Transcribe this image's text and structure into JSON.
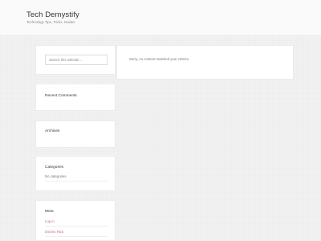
{
  "site": {
    "title": "Tech Demystify",
    "description": "Technology Tips, Tricks, Guides"
  },
  "search": {
    "placeholder": "Search this website…"
  },
  "widgets": {
    "recent_comments": {
      "title": "Recent Comments"
    },
    "archives": {
      "title": "Archives"
    },
    "categories": {
      "title": "Categories",
      "items": [
        "No categories"
      ]
    },
    "meta": {
      "title": "Meta",
      "links": [
        "Log in",
        "Entries RSS"
      ]
    }
  },
  "content": {
    "message": "Sorry, no content matched your criteria."
  },
  "colors": {
    "link": "#c0727d",
    "background": "#f2f2f2"
  }
}
